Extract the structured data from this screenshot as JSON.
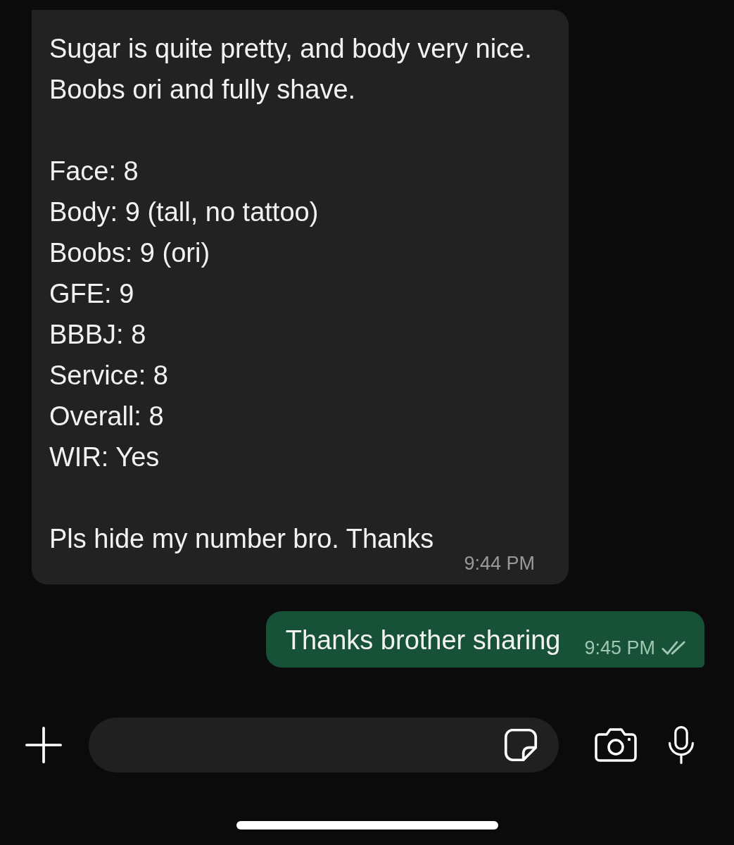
{
  "messages": [
    {
      "kind": "incoming",
      "paragraphs": [
        [
          "Sugar is quite pretty, and body very nice. Boobs ori and fully shave."
        ],
        [
          "Face: 8",
          "Body: 9 (tall, no tattoo)",
          "Boobs: 9 (ori)",
          "GFE: 9",
          "BBBJ: 8",
          "Service: 8",
          "Overall: 8",
          "WIR: Yes"
        ],
        [
          "Pls hide my number bro. Thanks"
        ]
      ],
      "time": "9:44 PM"
    },
    {
      "kind": "outgoing",
      "paragraphs": [
        [
          "Thanks brother sharing"
        ]
      ],
      "time": "9:45 PM",
      "read": false
    }
  ]
}
